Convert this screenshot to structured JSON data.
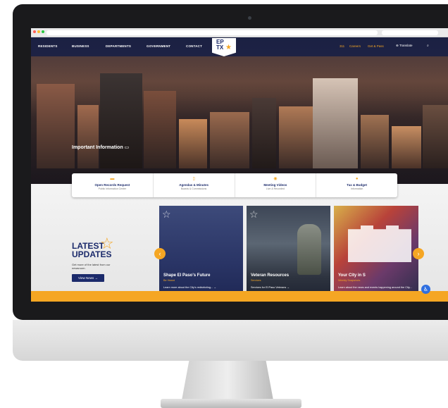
{
  "nav": {
    "items": [
      "RESIDENTS",
      "BUSINESS",
      "DEPARTMENTS",
      "GOVERNMENT",
      "CONTACT"
    ],
    "logo_top": "EP",
    "logo_bottom": "TX",
    "top_links": [
      "311",
      "Careers",
      "Get & Pass"
    ],
    "translate": "Translate"
  },
  "hero": {
    "important_title": "Important Information"
  },
  "info_cards": [
    {
      "icon": "folder-icon",
      "title": "Open Records Request",
      "subtitle": "Public Information Center"
    },
    {
      "icon": "document-icon",
      "title": "Agendas & Minutes",
      "subtitle": "Boards & Commissions"
    },
    {
      "icon": "video-icon",
      "title": "Meeting Videos",
      "subtitle": "Live & Recorded"
    },
    {
      "icon": "coins-icon",
      "title": "Tax & Budget",
      "subtitle": "Information"
    }
  ],
  "updates": {
    "title_line1": "LATEST",
    "title_line2": "UPDATES",
    "subtitle": "Get more of the latest from our newsroom.",
    "button": "View News →"
  },
  "cards": [
    {
      "title": "Shape El Paso's Future",
      "subtitle": "Be Heard",
      "link": "Learn more about the City's redistricting... →"
    },
    {
      "title": "Veteran Resources",
      "subtitle": "Services",
      "link": "Services for El Paso Veterans →"
    },
    {
      "title": "Your City in S",
      "subtitle": "Weekly Snapshots",
      "link": "Learn about the news and events happening around the City... →"
    }
  ],
  "colors": {
    "navy": "#1b2a6b",
    "accent": "#f5a623"
  }
}
